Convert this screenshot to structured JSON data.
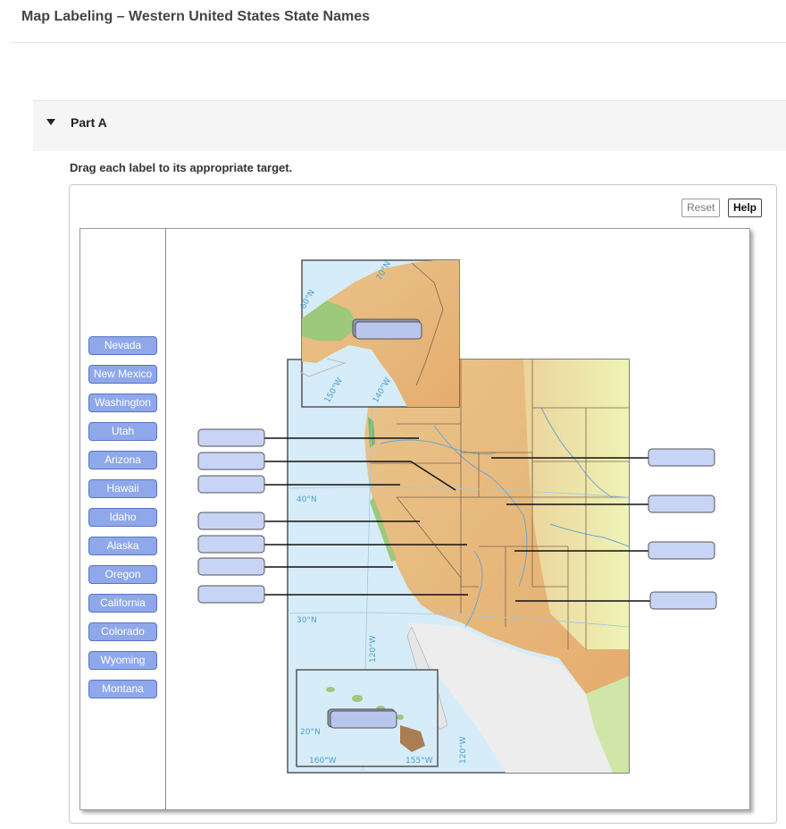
{
  "header": {
    "title": "Map Labeling – Western United States State Names"
  },
  "part": {
    "label": "Part A",
    "expanded": true
  },
  "instructions": "Drag each label to its appropriate target.",
  "toolbar": {
    "reset_label": "Reset",
    "help_label": "Help"
  },
  "labels": [
    "Nevada",
    "New Mexico",
    "Washington",
    "Utah",
    "Arizona",
    "Hawaii",
    "Idaho",
    "Alaska",
    "Oregon",
    "California",
    "Colorado",
    "Wyoming",
    "Montana"
  ],
  "map": {
    "alaska_inset": {
      "latitude_label": "70°N",
      "lat_label_2": "60°N",
      "lon_label_1": "150°W",
      "lon_label_2": "140°W"
    },
    "hawaii_inset": {
      "lat_label": "20°N",
      "lon_label_1": "160°W",
      "lon_label_2": "155°W"
    },
    "grid_labels": {
      "lat_40": "40°N",
      "lat_30": "30°N",
      "lon_120": "120°W",
      "lon_120b": "120°W"
    },
    "empty_targets": 11
  },
  "colors": {
    "chip_fill": "#8fa8ea",
    "chip_border": "#5a73c2",
    "target_fill": "#c7d4f5",
    "target_border": "#555555",
    "ocean": "#d6ecf8",
    "land": "#e8b87c"
  }
}
